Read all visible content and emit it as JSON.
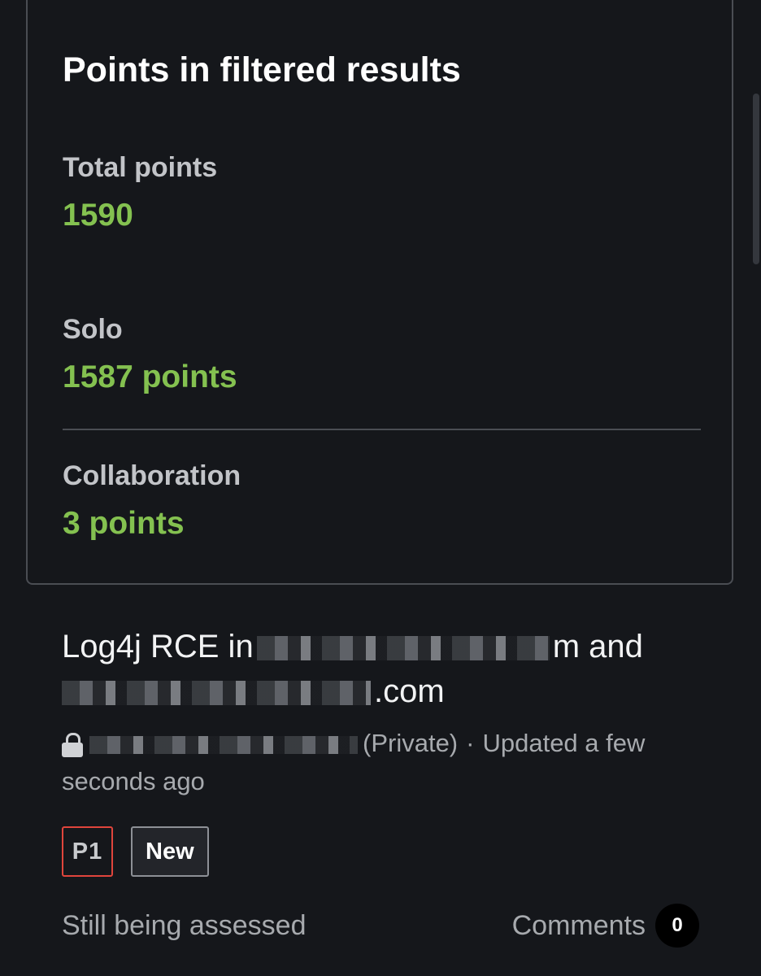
{
  "points_card": {
    "title": "Points in filtered results",
    "total": {
      "label": "Total points",
      "value": "1590"
    },
    "solo": {
      "label": "Solo",
      "value": "1587 points"
    },
    "collaboration": {
      "label": "Collaboration",
      "value": "3 points"
    }
  },
  "report": {
    "title_start": "Log4j RCE in",
    "title_mid": "m and",
    "title_end": ".com",
    "visibility": "(Private)",
    "separator": "·",
    "updated": "Updated a few seconds ago",
    "priority_badge": "P1",
    "state_badge": "New",
    "status": "Still being assessed",
    "comments_label": "Comments",
    "comments_count": "0"
  },
  "icons": {
    "lock": "lock-icon"
  },
  "colors": {
    "background": "#15171b",
    "points_green": "#84c150",
    "priority_red": "#e0453c"
  }
}
